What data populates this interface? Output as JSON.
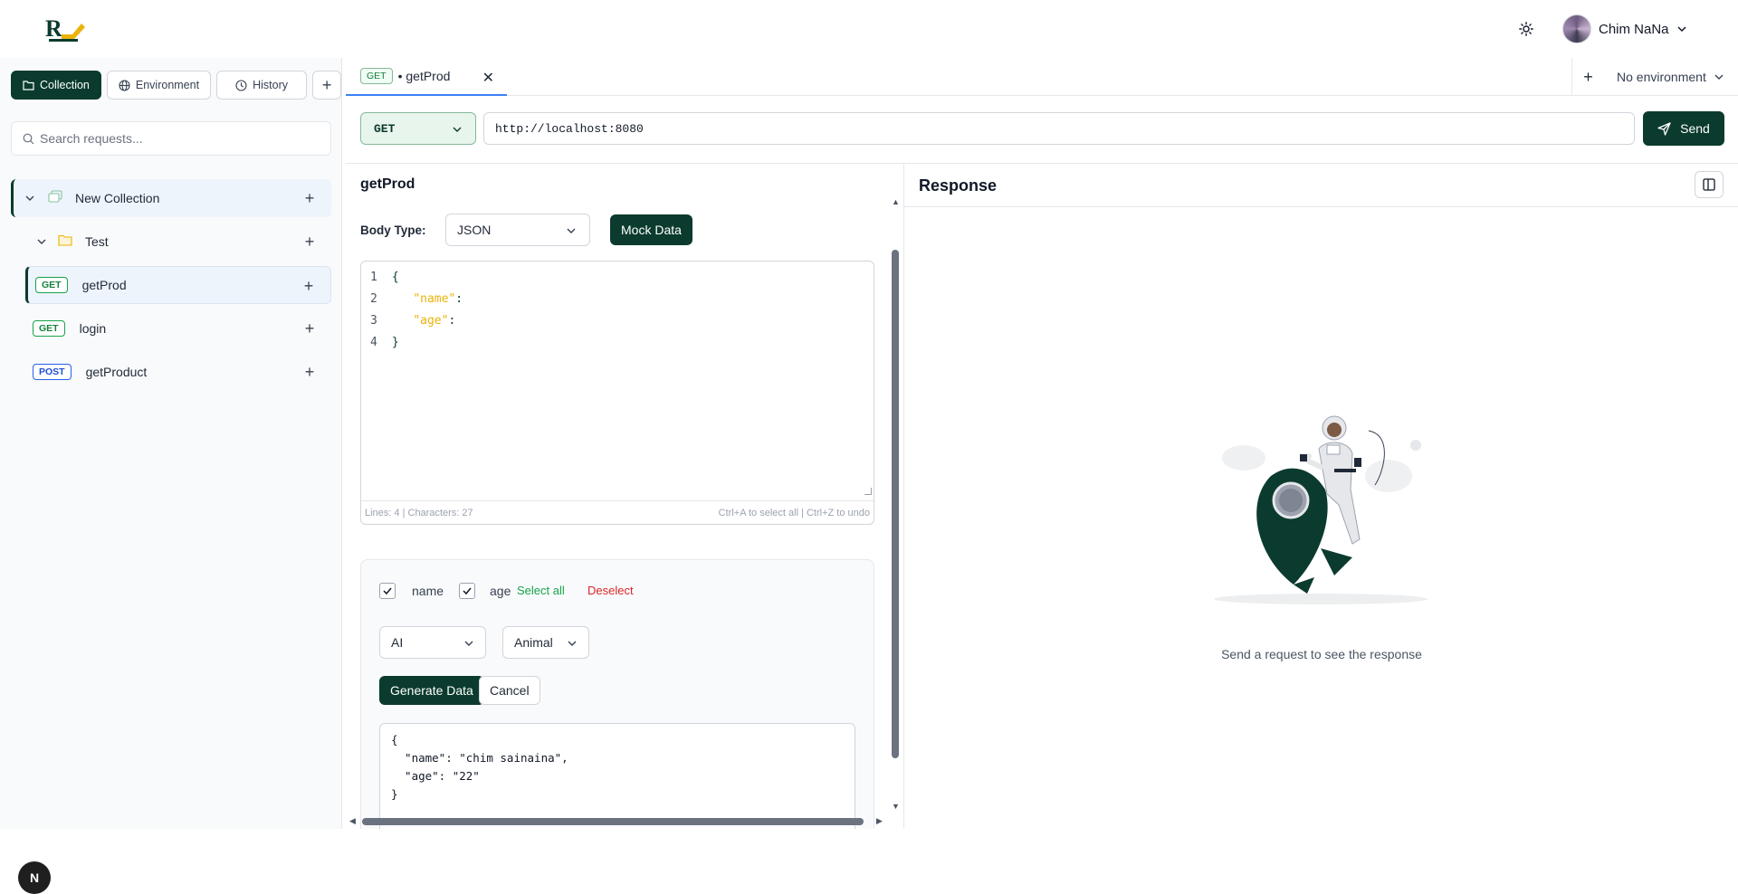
{
  "header": {
    "logo_text": "R",
    "user_name": "Chim NaNa"
  },
  "sidebar": {
    "tabs": [
      {
        "label": "Collection",
        "icon": "folder-icon",
        "active": true
      },
      {
        "label": "Environment",
        "icon": "globe-icon",
        "active": false
      },
      {
        "label": "History",
        "icon": "clock-icon",
        "active": false
      }
    ],
    "search_placeholder": "Search requests...",
    "collection": {
      "label": "New Collection"
    },
    "folder": {
      "label": "Test"
    },
    "requests": [
      {
        "method": "GET",
        "label": "getProd"
      },
      {
        "method": "GET",
        "label": "login"
      },
      {
        "method": "POST",
        "label": "getProduct"
      }
    ],
    "badge": "N"
  },
  "tabbar": {
    "tab_method": "GET",
    "tab_label": "• getProd",
    "environment": "No environment"
  },
  "request": {
    "method": "GET",
    "url": "http://localhost:8080",
    "send_label": "Send",
    "title": "getProd",
    "body_type_label": "Body Type:",
    "body_type": "JSON",
    "mock_button": "Mock Data",
    "code": [
      {
        "n": "1",
        "brace_open": "{",
        "key": "",
        "colon": "",
        "brace_close": ""
      },
      {
        "n": "2",
        "brace_open": "",
        "key": "\"name\"",
        "colon": ":",
        "brace_close": ""
      },
      {
        "n": "3",
        "brace_open": "",
        "key": "\"age\"",
        "colon": ":",
        "brace_close": ""
      },
      {
        "n": "4",
        "brace_open": "",
        "key": "",
        "colon": "",
        "brace_close": "}"
      }
    ],
    "editor_stats": "Lines: 4 | Characters: 27",
    "editor_hint": "Ctrl+A to select all | Ctrl+Z to undo"
  },
  "mock": {
    "fields": [
      {
        "label": "name",
        "checked": true
      },
      {
        "label": "age",
        "checked": true
      }
    ],
    "select_all": "Select all",
    "deselect": "Deselect",
    "source": "AI",
    "category": "Animal",
    "generate_label": "Generate Data",
    "cancel_label": "Cancel",
    "output": "{\n  \"name\": \"chim sainaina\",\n  \"age\": \"22\"\n}"
  },
  "response": {
    "title": "Response",
    "empty_message": "Send a request to see the response"
  },
  "colors": {
    "primary": "#0b3b2e",
    "get_green": "#15803d",
    "post_blue": "#1d4ed8",
    "json_key": "#eab308",
    "deselect_red": "#dc2626"
  }
}
